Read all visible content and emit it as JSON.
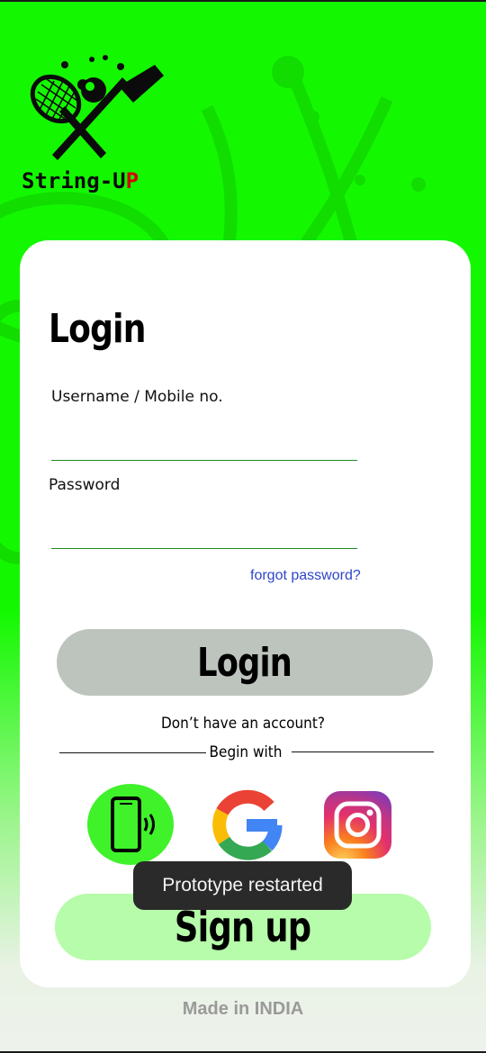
{
  "brand": {
    "logo_text_main": "String-U",
    "logo_text_accent": "P",
    "logo_icon": "racket-and-cricket-bat-icon"
  },
  "login": {
    "title": "Login",
    "username_label": "Username / Mobile no.",
    "username_value": "",
    "password_label": "Password",
    "password_value": "",
    "forgot_link": "forgot password?",
    "login_button": "Login"
  },
  "signup": {
    "no_account_text": "Don’t have an account?",
    "begin_with_text": "Begin with",
    "providers": [
      {
        "name": "phone",
        "icon": "phone-vibrate-icon"
      },
      {
        "name": "google",
        "icon": "google-icon"
      },
      {
        "name": "instagram",
        "icon": "instagram-icon"
      }
    ],
    "signup_button": "Sign up"
  },
  "toast": {
    "text": "Prototype restarted"
  },
  "footer": {
    "text": "Made in INDIA"
  },
  "colors": {
    "background": "#13f800",
    "card": "#ffffff",
    "login_button": "#bcc4bd",
    "signup_button": "#b6fcaa",
    "phone_button": "#3ff22a",
    "link": "#2f46c9",
    "field_underline": "#1e8a1e"
  }
}
